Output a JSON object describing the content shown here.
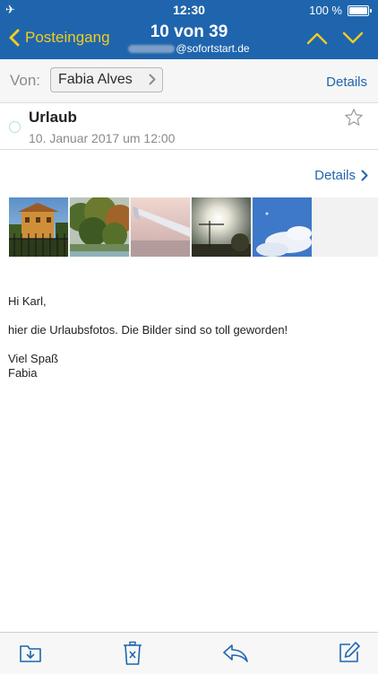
{
  "status_bar": {
    "time": "12:30",
    "battery": "100 %",
    "airplane_icon": "airplane-icon"
  },
  "nav": {
    "back_label": "Posteingang",
    "count": "10 von 39",
    "account_domain": "@sofortstart.de",
    "accent_color": "#f2cc22",
    "bar_color": "#1f65ad"
  },
  "header": {
    "from_label": "Von:",
    "sender": "Fabia Alves",
    "details_label": "Details"
  },
  "message": {
    "subject": "Urlaub",
    "date": "10. Januar 2017 um 12:00",
    "details_label": "Details",
    "attachments": [
      {
        "name": "thumbnail-villa"
      },
      {
        "name": "thumbnail-trees"
      },
      {
        "name": "thumbnail-airplane-wing"
      },
      {
        "name": "thumbnail-sunset-crane"
      },
      {
        "name": "thumbnail-sky-clouds"
      }
    ],
    "body": {
      "greeting": "Hi Karl,",
      "line1": "hier die Urlaubsfotos. Die Bilder sind so toll geworden!",
      "closing": "Viel Spaß",
      "signature": "Fabia"
    }
  },
  "toolbar": {
    "icons": [
      "move-to-folder-icon",
      "trash-icon",
      "reply-icon",
      "compose-icon"
    ]
  }
}
